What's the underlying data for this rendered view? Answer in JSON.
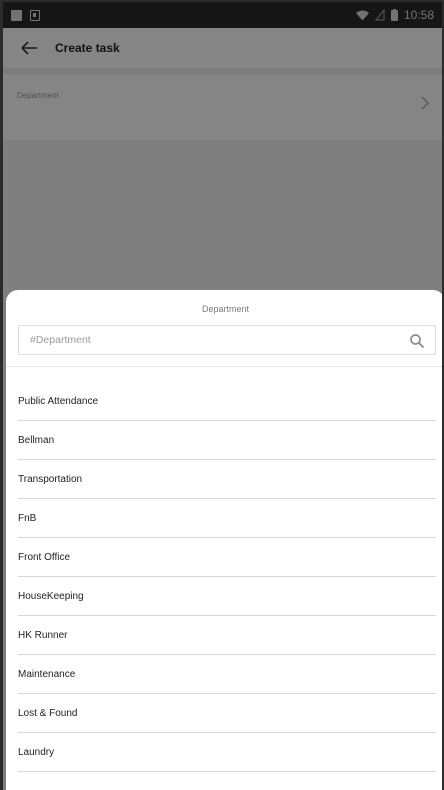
{
  "status_bar": {
    "time": "10:58"
  },
  "header": {
    "back_icon": "arrow-left-icon",
    "title": "Create task"
  },
  "form": {
    "department_label": "Department",
    "chevron_icon": "chevron-right-icon"
  },
  "sheet": {
    "title": "Department",
    "search_placeholder": "#Department",
    "search_icon": "search-icon",
    "items": [
      {
        "label": "Public Attendance"
      },
      {
        "label": "Bellman"
      },
      {
        "label": "Transportation"
      },
      {
        "label": "FnB"
      },
      {
        "label": "Front Office"
      },
      {
        "label": "HouseKeeping"
      },
      {
        "label": "HK Runner"
      },
      {
        "label": "Maintenance"
      },
      {
        "label": "Lost & Found"
      },
      {
        "label": "Laundry"
      }
    ]
  }
}
